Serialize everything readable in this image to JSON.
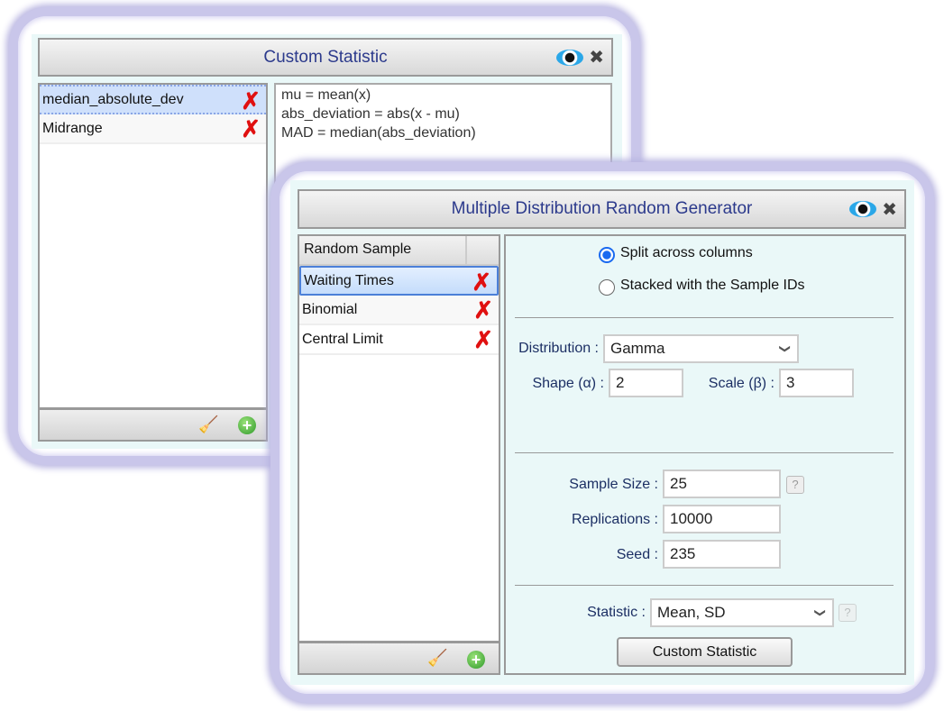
{
  "custom_statistic": {
    "title": "Custom Statistic",
    "items": [
      {
        "label": "median_absolute_dev",
        "selected": true
      },
      {
        "label": "Midrange",
        "selected": false
      }
    ],
    "code_lines": [
      "mu = mean(x)",
      "abs_deviation = abs(x - mu)",
      "MAD = median(abs_deviation)"
    ]
  },
  "generator": {
    "title": "Multiple Distribution Random Generator",
    "list_header": "Random Sample",
    "items": [
      {
        "label": "Waiting Times",
        "selected": true
      },
      {
        "label": "Binomial",
        "selected": false
      },
      {
        "label": "Central Limit",
        "selected": false
      }
    ],
    "output_options": [
      {
        "label": "Split across columns",
        "checked": true
      },
      {
        "label": "Stacked with the Sample IDs",
        "checked": false
      }
    ],
    "distribution_label": "Distribution :",
    "distribution_value": "Gamma",
    "shape_label": "Shape (α) :",
    "shape_value": "2",
    "scale_label": "Scale (β) :",
    "scale_value": "3",
    "sample_size_label": "Sample Size :",
    "sample_size_value": "25",
    "replications_label": "Replications :",
    "replications_value": "10000",
    "seed_label": "Seed :",
    "seed_value": "235",
    "statistic_label": "Statistic :",
    "statistic_value": "Mean, SD",
    "custom_statistic_button": "Custom Statistic",
    "help_glyph": "?"
  },
  "icons": {
    "delete": "✗",
    "close": "✖",
    "add": "+",
    "broom": "🧹"
  }
}
